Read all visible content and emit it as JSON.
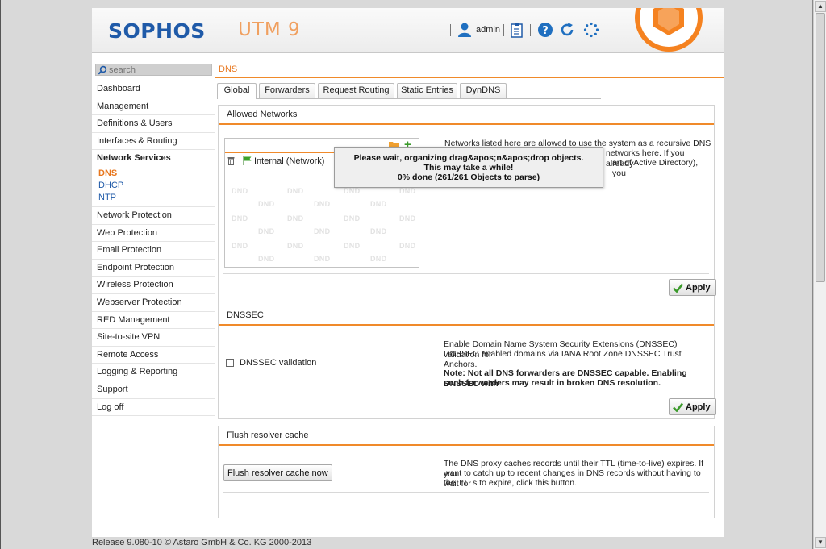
{
  "header": {
    "logo": "SOPHOS",
    "product": "UTM 9",
    "user": "admin",
    "icons": [
      "user-icon",
      "clipboard-icon",
      "help-icon",
      "reload-icon",
      "spinner-icon"
    ]
  },
  "search": {
    "placeholder": "search"
  },
  "sidebar": {
    "items": [
      {
        "label": "Dashboard"
      },
      {
        "label": "Management"
      },
      {
        "label": "Definitions & Users"
      },
      {
        "label": "Interfaces & Routing"
      },
      {
        "label": "Network Services",
        "expanded": true,
        "children": [
          {
            "label": "DNS",
            "current": true
          },
          {
            "label": "DHCP"
          },
          {
            "label": "NTP"
          }
        ]
      },
      {
        "label": "Network Protection"
      },
      {
        "label": "Web Protection"
      },
      {
        "label": "Email Protection"
      },
      {
        "label": "Endpoint Protection"
      },
      {
        "label": "Wireless Protection"
      },
      {
        "label": "Webserver Protection"
      },
      {
        "label": "RED Management"
      },
      {
        "label": "Site-to-site VPN"
      },
      {
        "label": "Remote Access"
      },
      {
        "label": "Logging & Reporting"
      },
      {
        "label": "Support"
      },
      {
        "label": "Log off"
      }
    ]
  },
  "breadcrumb": "DNS",
  "tabs": [
    {
      "label": "Global",
      "active": true
    },
    {
      "label": "Forwarders"
    },
    {
      "label": "Request Routing"
    },
    {
      "label": "Static Entries"
    },
    {
      "label": "DynDNS"
    }
  ],
  "allowed_networks": {
    "title": "Allowed Networks",
    "entry": "Internal (Network)",
    "dnd_label": "DND",
    "help_lines": [
      "Networks listed here are allowed to use the system as a recursive DNS",
      "networks here. If you already",
      "art of Active Directory), you"
    ],
    "apply_label": "Apply"
  },
  "overlay": {
    "line1": "Please wait, organizing drag&apos;n&apos;drop objects.",
    "line2": "This may take a while!",
    "line3": "0% done (261/261 Objects to parse)"
  },
  "dnssec": {
    "title": "DNSSEC",
    "checkbox_label": "DNSSEC validation",
    "checked": false,
    "help_line1": "Enable Domain Name System Security Extensions (DNSSEC) validation for",
    "help_line2": "DNSSEC enabled domains via IANA Root Zone DNSSEC Trust Anchors.",
    "note_line1": "Note: Not all DNS forwarders are DNSSEC capable. Enabling DNSSEC with",
    "note_line2": "such forwarders may result in broken DNS resolution.",
    "apply_label": "Apply"
  },
  "flush": {
    "title": "Flush resolver cache",
    "button_label": "Flush resolver cache now",
    "help_line1": "The DNS proxy caches records until their TTL (time-to-live) expires. If you",
    "help_line2": "want to catch up to recent changes in DNS records without having to wait for",
    "help_line3": "the TTLs to expire, click this button."
  },
  "footer": "Release 9.080-10 © Astaro GmbH & Co. KG 2000-2013",
  "colors": {
    "accent": "#f08a2a",
    "brand": "#1f5aa8"
  }
}
